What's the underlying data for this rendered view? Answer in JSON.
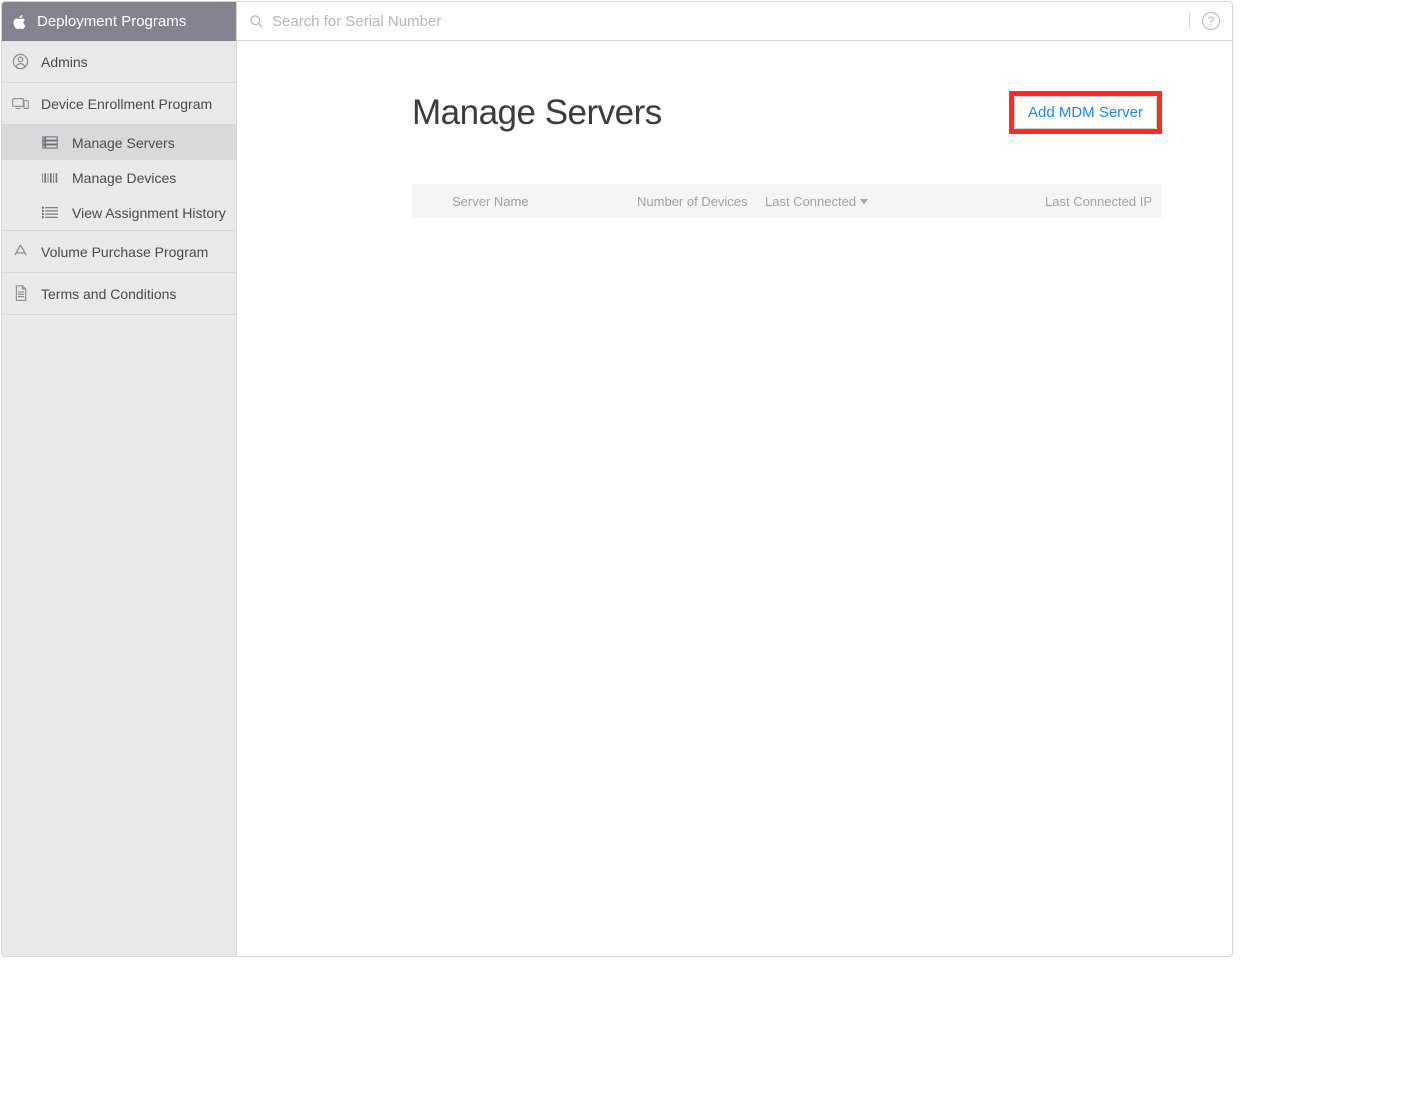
{
  "sidebar": {
    "title": "Deployment Programs",
    "items": [
      {
        "label": "Admins"
      },
      {
        "label": "Device Enrollment Program"
      },
      {
        "label": "Volume Purchase Program"
      },
      {
        "label": "Terms and Conditions"
      }
    ],
    "subitems": [
      {
        "label": "Manage Servers"
      },
      {
        "label": "Manage Devices"
      },
      {
        "label": "View Assignment History"
      }
    ]
  },
  "search": {
    "placeholder": "Search for Serial Number"
  },
  "page": {
    "title": "Manage Servers",
    "add_button": "Add MDM Server"
  },
  "table": {
    "headers": {
      "server_name": "Server Name",
      "num_devices": "Number of Devices",
      "last_connected": "Last Connected",
      "last_ip": "Last Connected IP"
    }
  }
}
